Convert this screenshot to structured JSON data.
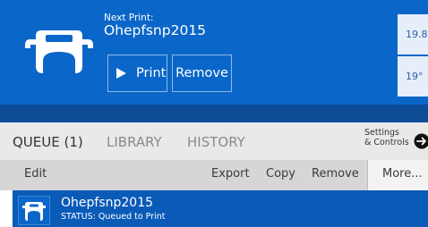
{
  "header": {
    "next_print_label": "Next Print:",
    "next_print_name": "Ohepfsnp2015",
    "print_button_label": "Print",
    "remove_button_label": "Remove",
    "temperatures": [
      "19.8°",
      "19°"
    ]
  },
  "tabs": [
    {
      "label": "QUEUE (1)",
      "active": true
    },
    {
      "label": "LIBRARY",
      "active": false
    },
    {
      "label": "HISTORY",
      "active": false
    }
  ],
  "settings": {
    "line1": "Settings",
    "line2": "& Controls"
  },
  "toolbar": {
    "edit": "Edit",
    "export": "Export",
    "copy": "Copy",
    "remove": "Remove",
    "more": "More..."
  },
  "queue": {
    "items": [
      {
        "name": "Ohepfsnp2015",
        "status": "STATUS: Queued to Print"
      }
    ]
  },
  "colors": {
    "header_blue": "#0a66c8",
    "header_strip": "#0d4d98",
    "queue_item_blue": "#0a5ab8",
    "tabbar_gray": "#e9e9e9",
    "toolbar_gray": "#d6d6d6"
  },
  "icons": {
    "logo": "matterhackers-logo-icon",
    "print": "play-icon",
    "settings": "arrow-right-circle-icon",
    "item_thumb": "part-thumbnail-icon"
  }
}
